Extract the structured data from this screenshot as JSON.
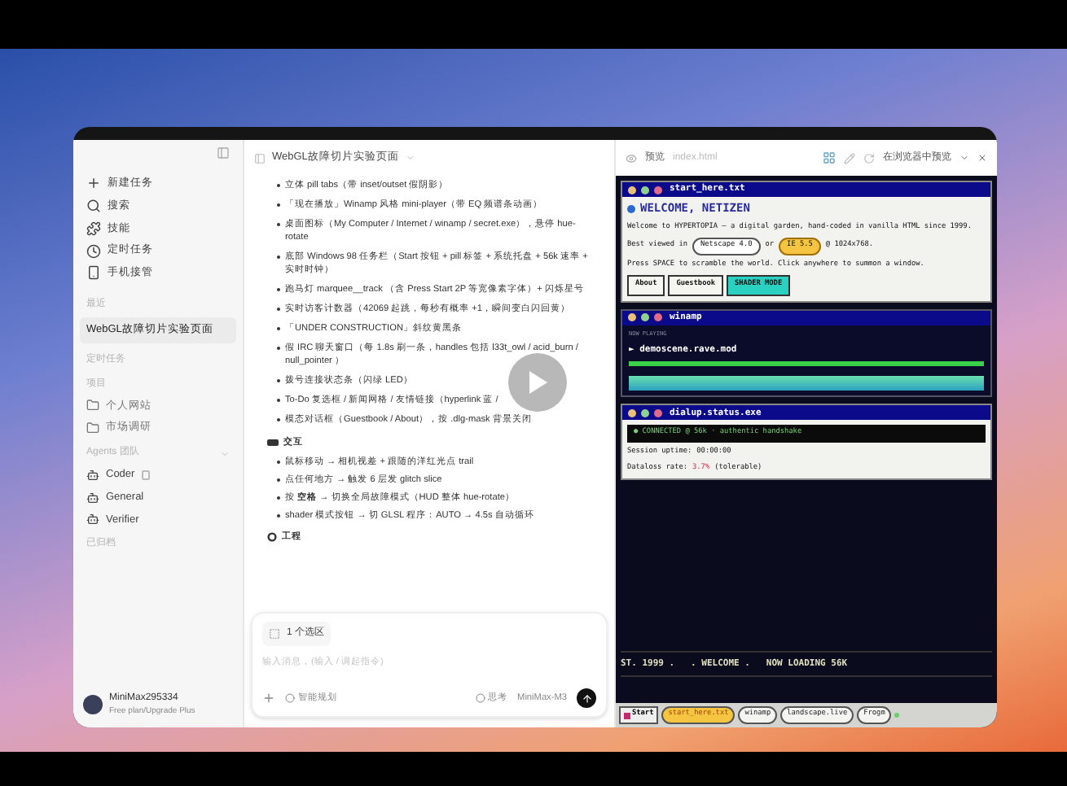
{
  "sidebar": {
    "nav": [
      {
        "label": "新建任务"
      },
      {
        "label": "搜索"
      },
      {
        "label": "技能"
      },
      {
        "label": "定时任务"
      },
      {
        "label": "手机接管"
      }
    ],
    "recent_header": "最近",
    "recent": [
      {
        "label": "WebGL故障切片实验页面",
        "selected": true
      }
    ],
    "scheduled_header": "定时任务",
    "projects_header": "项目",
    "projects": [
      {
        "label": "个人网站"
      },
      {
        "label": "市场调研"
      }
    ],
    "agents_header": "Agents 团队",
    "agents": [
      {
        "label": "Coder",
        "badge": true
      },
      {
        "label": "General",
        "badge": false
      },
      {
        "label": "Verifier",
        "badge": false
      }
    ],
    "archived_header": "已归档",
    "user": {
      "name": "MiniMax295334",
      "plan": "Free plan/Upgrade Plus"
    }
  },
  "chat": {
    "title": "WebGL故障切片实验页面",
    "features": [
      "立体 pill tabs（带 inset/outset 假阴影）",
      "「现在播放」Winamp 风格 mini-player（带 EQ 频谱条动画）",
      "桌面图标（My Computer / Internet / winamp / secret.exe），悬停 hue-rotate",
      "底部 Windows 98 任务栏（Start 按钮 + pill 标签 + 系统托盘 + 56k 速率 + 实时时钟）",
      "跑马灯 marquee__track （含 Press Start 2P 等宽像素字体）+ 闪烁星号",
      "实时访客计数器（42069 起跳，每秒有概率 +1，瞬间变白闪回黄）",
      "「UNDER CONSTRUCTION」斜纹黄黑条",
      "假 IRC 聊天窗口（每 1.8s 刷一条，handles 包括 l33t_owl / acid_burn / null_pointer ）",
      "拨号连接状态条（闪绿 LED）",
      "To-Do 复选框 / 新闻网格 / 友情链接（hyperlink 蓝 /",
      "模态对话框（Guestbook / About），按 .dlg-mask 背景关闭"
    ],
    "interaction_heading": "交互",
    "interactions": [
      "鼠标移动 → 相机视差 + 跟随的洋红光点 trail",
      "点任何地方 → 触发 6 层发 glitch slice",
      "按 **空格** → 切换全局故障模式（HUD 整体 hue-rotate）",
      "shader 模式按钮 → 切 GLSL 程序：AUTO → 4.5s 自动循环"
    ],
    "engineering_heading": "工程",
    "composer": {
      "chip": "1 个选区",
      "placeholder": "输入消息，(输入 / 调起指令)",
      "mode": "智能规划",
      "think": "思考",
      "model": "MiniMax-M3"
    }
  },
  "preview": {
    "tab": "预览",
    "file": "index.html",
    "open_browser": "在浏览器中预览",
    "welcome": {
      "title": "start_here.txt",
      "heading": "WELCOME, NETIZEN",
      "intro": "Welcome to HYPERTOPIA — a digital garden, hand-coded in vanilla HTML since 1999.",
      "best": "Best viewed in",
      "netscape": "Netscape 4.0",
      "or": "or",
      "ie": "IE 5.5",
      "res": "@ 1024x768.",
      "hint": "Press SPACE to scramble the world. Click anywhere to summon a window.",
      "buttons": [
        {
          "label": "About",
          "kind": "plain"
        },
        {
          "label": "Guestbook",
          "kind": "plain"
        },
        {
          "label": "SHADER MODE",
          "kind": "accent"
        }
      ]
    },
    "winamp": {
      "title": "winamp",
      "now": "NOW PLAYING",
      "track": "► demoscene.rave.mod",
      "level": 1
    },
    "dialup": {
      "title": "dialup.status.exe",
      "status": "● CONNECTED @ 56k · authentic handshake",
      "uptime_label": "Session uptime:",
      "uptime": "00:00:00",
      "loss_label": "Dataloss rate:",
      "loss": "3.7%",
      "loss_note": "(tolerable)"
    },
    "marquee": "ST. 1999 .   . WELCOME .   NOW LOADING 56K",
    "taskbar": {
      "start": "Start",
      "tabs": [
        {
          "label": "start_here.txt",
          "selected": true
        },
        {
          "label": "winamp",
          "selected": false
        },
        {
          "label": "landscape.live",
          "selected": false
        },
        {
          "label": "Frogm",
          "selected": false
        }
      ]
    }
  }
}
